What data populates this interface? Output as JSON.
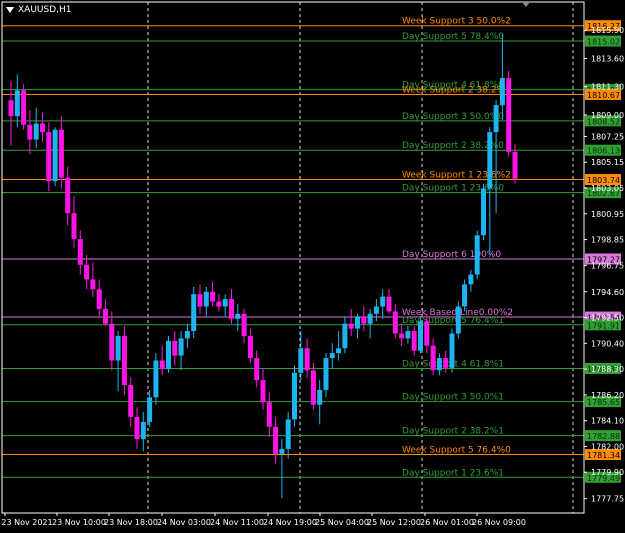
{
  "window": {
    "symbol_label": "XAUUSD,H1"
  },
  "chart_data": {
    "type": "candlestick",
    "symbol": "XAUUSD",
    "timeframe": "H1",
    "ylim": [
      1776.58,
      1818.2
    ],
    "colors": {
      "background": "#000000",
      "bull": "#1eb4f0",
      "bear": "#ff14e6",
      "week_level": "#ff8c00",
      "day_level": "#32a032",
      "pivot_level": "#dc78dc",
      "axis": "#ffffff"
    },
    "y_ticks": [
      "1815.90",
      "1813.60",
      "1811.30",
      "1809.00",
      "1807.25",
      "1805.15",
      "1803.05",
      "1800.95",
      "1798.85",
      "1796.75",
      "1794.60",
      "1792.50",
      "1790.40",
      "1788.30",
      "1786.20",
      "1784.10",
      "1782.00",
      "1779.90",
      "1777.75"
    ],
    "x_ticks": [
      "23 Nov 2021",
      "23 Nov 10:00",
      "23 Nov 18:00",
      "24 Nov 03:00",
      "24 Nov 11:00",
      "24 Nov 19:00",
      "25 Nov 04:00",
      "25 Nov 12:00",
      "26 Nov 01:00",
      "26 Nov 09:00"
    ],
    "dashed_separators": [
      "23 Nov 18:00",
      "24 Nov 19:00",
      "26 Nov 01:00",
      "26 Nov 09:00"
    ],
    "levels": [
      {
        "label": "Week Support 3 50.0%2",
        "price": 1816.27,
        "price_label": "1816.27",
        "kind": "week"
      },
      {
        "label": "Day Support 5 78.4%0",
        "price": 1815.02,
        "price_label": "1815.02",
        "kind": "day"
      },
      {
        "label": "Day Support 4 61.8%0",
        "price": 1811.06,
        "price_label": "1811.06",
        "kind": "day"
      },
      {
        "label": "Week Support 2 38.2%2",
        "price": 1810.67,
        "price_label": "1810.67",
        "kind": "week"
      },
      {
        "label": "Day Support 3 50.0%0",
        "price": 1808.52,
        "price_label": "1808.52",
        "kind": "day"
      },
      {
        "label": "Day Support 2 38.2%0",
        "price": 1806.13,
        "price_label": "1806.13",
        "kind": "day"
      },
      {
        "label": "Week Support 1 23.6%2",
        "price": 1803.74,
        "price_label": "1803.74",
        "kind": "week"
      },
      {
        "label": "Day Support 1 23.6%0",
        "price": 1802.67,
        "price_label": "1802.67",
        "kind": "day"
      },
      {
        "label": "Day Support 6 100%0",
        "price": 1797.27,
        "price_label": "1797.27",
        "kind": "pivot"
      },
      {
        "label": "Week Based Line0.00%2",
        "price": 1792.54,
        "price_label": "1792.54",
        "kind": "pivot"
      },
      {
        "label": "Day Support 5 76.4%1",
        "price": 1791.91,
        "price_label": "1791.91",
        "kind": "day"
      },
      {
        "label": "Day Support 4 61.8%1",
        "price": 1788.35,
        "price_label": "1788.35",
        "kind": "day"
      },
      {
        "label": "Day Support 3 50.0%1",
        "price": 1785.65,
        "price_label": "1785.65",
        "kind": "day"
      },
      {
        "label": "Day Support 2 38.2%1",
        "price": 1782.88,
        "price_label": "1782.88",
        "kind": "day"
      },
      {
        "label": "Week Support 5 76.4%0",
        "price": 1781.34,
        "price_label": "1781.34",
        "kind": "week"
      },
      {
        "label": "Day Support 1 23.6%1",
        "price": 1779.49,
        "price_label": "1779.49",
        "kind": "day"
      }
    ],
    "candles": [
      {
        "o": 1810.2,
        "h": 1811.8,
        "l": 1806.5,
        "c": 1808.9
      },
      {
        "o": 1808.9,
        "h": 1812.3,
        "l": 1808.0,
        "c": 1811.0
      },
      {
        "o": 1811.0,
        "h": 1811.5,
        "l": 1807.8,
        "c": 1808.2
      },
      {
        "o": 1808.2,
        "h": 1809.4,
        "l": 1805.8,
        "c": 1807.0
      },
      {
        "o": 1807.0,
        "h": 1809.6,
        "l": 1806.3,
        "c": 1808.3
      },
      {
        "o": 1808.3,
        "h": 1809.2,
        "l": 1806.8,
        "c": 1807.6
      },
      {
        "o": 1807.6,
        "h": 1808.4,
        "l": 1802.8,
        "c": 1803.6
      },
      {
        "o": 1803.6,
        "h": 1808.0,
        "l": 1803.2,
        "c": 1807.8
      },
      {
        "o": 1807.8,
        "h": 1808.9,
        "l": 1803.0,
        "c": 1803.9
      },
      {
        "o": 1803.9,
        "h": 1804.8,
        "l": 1800.0,
        "c": 1801.0
      },
      {
        "o": 1801.0,
        "h": 1802.4,
        "l": 1798.2,
        "c": 1798.9
      },
      {
        "o": 1798.9,
        "h": 1799.6,
        "l": 1796.0,
        "c": 1796.8
      },
      {
        "o": 1796.8,
        "h": 1797.6,
        "l": 1794.8,
        "c": 1795.6
      },
      {
        "o": 1795.6,
        "h": 1797.0,
        "l": 1794.2,
        "c": 1794.8
      },
      {
        "o": 1794.8,
        "h": 1795.6,
        "l": 1792.6,
        "c": 1793.2
      },
      {
        "o": 1793.2,
        "h": 1794.0,
        "l": 1791.8,
        "c": 1792.0
      },
      {
        "o": 1792.0,
        "h": 1793.0,
        "l": 1788.2,
        "c": 1789.0
      },
      {
        "o": 1789.0,
        "h": 1791.4,
        "l": 1786.5,
        "c": 1791.0
      },
      {
        "o": 1791.0,
        "h": 1791.8,
        "l": 1786.2,
        "c": 1787.0
      },
      {
        "o": 1787.0,
        "h": 1787.6,
        "l": 1783.6,
        "c": 1784.4
      },
      {
        "o": 1784.4,
        "h": 1785.2,
        "l": 1781.8,
        "c": 1782.6
      },
      {
        "o": 1782.6,
        "h": 1784.8,
        "l": 1781.6,
        "c": 1784.0
      },
      {
        "o": 1784.0,
        "h": 1786.6,
        "l": 1783.6,
        "c": 1786.0
      },
      {
        "o": 1786.0,
        "h": 1789.6,
        "l": 1785.4,
        "c": 1789.0
      },
      {
        "o": 1789.0,
        "h": 1790.2,
        "l": 1787.8,
        "c": 1788.3
      },
      {
        "o": 1788.3,
        "h": 1791.0,
        "l": 1788.0,
        "c": 1790.6
      },
      {
        "o": 1790.6,
        "h": 1791.4,
        "l": 1788.6,
        "c": 1789.4
      },
      {
        "o": 1789.4,
        "h": 1791.4,
        "l": 1788.2,
        "c": 1790.8
      },
      {
        "o": 1790.8,
        "h": 1792.0,
        "l": 1790.0,
        "c": 1791.4
      },
      {
        "o": 1791.4,
        "h": 1795.0,
        "l": 1790.8,
        "c": 1794.4
      },
      {
        "o": 1794.4,
        "h": 1795.2,
        "l": 1792.8,
        "c": 1793.4
      },
      {
        "o": 1793.4,
        "h": 1795.0,
        "l": 1792.6,
        "c": 1794.6
      },
      {
        "o": 1794.6,
        "h": 1795.4,
        "l": 1793.4,
        "c": 1793.8
      },
      {
        "o": 1793.8,
        "h": 1794.4,
        "l": 1793.0,
        "c": 1793.4
      },
      {
        "o": 1793.4,
        "h": 1794.4,
        "l": 1792.6,
        "c": 1794.0
      },
      {
        "o": 1794.0,
        "h": 1794.8,
        "l": 1792.0,
        "c": 1792.4
      },
      {
        "o": 1792.4,
        "h": 1793.6,
        "l": 1791.4,
        "c": 1792.8
      },
      {
        "o": 1792.8,
        "h": 1793.2,
        "l": 1790.4,
        "c": 1791.0
      },
      {
        "o": 1791.0,
        "h": 1791.6,
        "l": 1788.8,
        "c": 1789.2
      },
      {
        "o": 1789.2,
        "h": 1789.8,
        "l": 1786.8,
        "c": 1787.4
      },
      {
        "o": 1787.4,
        "h": 1788.4,
        "l": 1785.0,
        "c": 1785.6
      },
      {
        "o": 1785.6,
        "h": 1786.4,
        "l": 1782.8,
        "c": 1783.6
      },
      {
        "o": 1783.6,
        "h": 1784.4,
        "l": 1780.6,
        "c": 1781.4
      },
      {
        "o": 1781.4,
        "h": 1782.6,
        "l": 1777.8,
        "c": 1781.8
      },
      {
        "o": 1781.8,
        "h": 1784.8,
        "l": 1781.0,
        "c": 1784.2
      },
      {
        "o": 1784.2,
        "h": 1788.6,
        "l": 1783.6,
        "c": 1788.0
      },
      {
        "o": 1788.0,
        "h": 1791.4,
        "l": 1787.4,
        "c": 1790.0
      },
      {
        "o": 1790.0,
        "h": 1790.8,
        "l": 1787.6,
        "c": 1788.2
      },
      {
        "o": 1788.2,
        "h": 1788.8,
        "l": 1785.0,
        "c": 1785.4
      },
      {
        "o": 1785.4,
        "h": 1787.4,
        "l": 1783.8,
        "c": 1786.6
      },
      {
        "o": 1786.6,
        "h": 1789.6,
        "l": 1786.0,
        "c": 1789.2
      },
      {
        "o": 1789.2,
        "h": 1790.4,
        "l": 1788.4,
        "c": 1789.6
      },
      {
        "o": 1789.6,
        "h": 1791.4,
        "l": 1789.0,
        "c": 1790.0
      },
      {
        "o": 1790.0,
        "h": 1792.6,
        "l": 1789.6,
        "c": 1792.0
      },
      {
        "o": 1792.0,
        "h": 1793.2,
        "l": 1791.0,
        "c": 1791.6
      },
      {
        "o": 1791.6,
        "h": 1792.8,
        "l": 1790.8,
        "c": 1792.6
      },
      {
        "o": 1792.6,
        "h": 1793.4,
        "l": 1791.4,
        "c": 1792.0
      },
      {
        "o": 1792.0,
        "h": 1793.2,
        "l": 1790.8,
        "c": 1792.8
      },
      {
        "o": 1792.8,
        "h": 1794.0,
        "l": 1792.2,
        "c": 1793.4
      },
      {
        "o": 1793.4,
        "h": 1794.8,
        "l": 1792.4,
        "c": 1794.2
      },
      {
        "o": 1794.2,
        "h": 1794.8,
        "l": 1792.8,
        "c": 1793.0
      },
      {
        "o": 1793.0,
        "h": 1793.6,
        "l": 1790.8,
        "c": 1791.2
      },
      {
        "o": 1791.2,
        "h": 1792.0,
        "l": 1790.2,
        "c": 1790.8
      },
      {
        "o": 1790.8,
        "h": 1791.8,
        "l": 1790.4,
        "c": 1791.4
      },
      {
        "o": 1791.4,
        "h": 1791.8,
        "l": 1789.4,
        "c": 1789.8
      },
      {
        "o": 1789.8,
        "h": 1792.6,
        "l": 1789.6,
        "c": 1792.2
      },
      {
        "o": 1792.2,
        "h": 1792.8,
        "l": 1789.6,
        "c": 1790.2
      },
      {
        "o": 1790.2,
        "h": 1790.8,
        "l": 1787.8,
        "c": 1788.2
      },
      {
        "o": 1788.2,
        "h": 1789.6,
        "l": 1787.8,
        "c": 1789.2
      },
      {
        "o": 1789.2,
        "h": 1789.8,
        "l": 1788.0,
        "c": 1788.4
      },
      {
        "o": 1788.4,
        "h": 1791.6,
        "l": 1788.0,
        "c": 1791.2
      },
      {
        "o": 1791.2,
        "h": 1793.8,
        "l": 1790.8,
        "c": 1793.4
      },
      {
        "o": 1793.4,
        "h": 1795.6,
        "l": 1793.0,
        "c": 1795.2
      },
      {
        "o": 1795.2,
        "h": 1796.4,
        "l": 1794.6,
        "c": 1796.0
      },
      {
        "o": 1796.0,
        "h": 1799.6,
        "l": 1795.6,
        "c": 1799.2
      },
      {
        "o": 1799.2,
        "h": 1803.4,
        "l": 1798.8,
        "c": 1803.0
      },
      {
        "o": 1803.0,
        "h": 1808.0,
        "l": 1797.6,
        "c": 1807.6
      },
      {
        "o": 1807.6,
        "h": 1810.2,
        "l": 1801.0,
        "c": 1809.8
      },
      {
        "o": 1809.8,
        "h": 1815.6,
        "l": 1808.6,
        "c": 1812.0
      },
      {
        "o": 1812.0,
        "h": 1812.6,
        "l": 1805.6,
        "c": 1806.0
      },
      {
        "o": 1806.0,
        "h": 1806.6,
        "l": 1803.4,
        "c": 1803.8
      }
    ]
  }
}
